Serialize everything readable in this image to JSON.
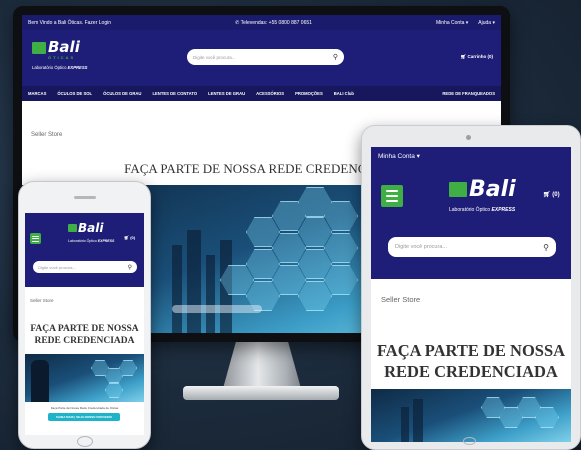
{
  "desktop": {
    "topbar": {
      "welcome": "Bem Vindo a Bali Óticas. Fazer Login",
      "phone": "Televendas: +55 0800 887 0651",
      "account": "Minha Conta",
      "help": "Ajuda"
    },
    "logo": {
      "name": "Bali",
      "sub": "ÓTICAS",
      "tagline_prefix": "Laboratório Óptico",
      "tagline_bold": "EXPRESS"
    },
    "search": {
      "placeholder": "Digite você procura..."
    },
    "cart": "Carrinho (0)",
    "nav": [
      "MARCAS",
      "ÓCULOS DE SOL",
      "ÓCULOS DE GRAU",
      "LENTES DE CONTATO",
      "LENTES DE GRAU",
      "ACESSÓRIOS",
      "PROMOÇÕES",
      "BALI Club"
    ],
    "nav_right": "REDE DE FRANQUEADOS",
    "seller_store": "Seller Store",
    "banner_title": "FAÇA PARTE DE NOSSA REDE CREDENCIADA"
  },
  "tablet": {
    "account": "Minha Conta",
    "logo": {
      "name": "Bali",
      "tagline_prefix": "Laboratório Óptico",
      "tagline_bold": "EXPRESS"
    },
    "cart": "(0)",
    "search": {
      "placeholder": "Digite você procura..."
    },
    "seller_store": "Seller Store",
    "banner_title": "FAÇA PARTE DE NOSSA REDE CREDENCIADA"
  },
  "phone": {
    "logo": {
      "name": "Bali",
      "tagline_prefix": "Laboratório Óptico",
      "tagline_bold": "EXPRESS"
    },
    "cart": "(0)",
    "search": {
      "placeholder": "Digite você procura..."
    },
    "seller_store": "Seller Store",
    "banner_title": "FAÇA PARTE DE NOSSA REDE CREDENCIADA",
    "caption": "Faça Parte da Nossa Rede Credenciada de Oticas",
    "cta": "SAIBA MAIS | SEJA NOSSO PARCEIRO"
  },
  "colors": {
    "navy": "#1e1e78",
    "green": "#3fae45",
    "cyan": "#1eb3c9"
  }
}
